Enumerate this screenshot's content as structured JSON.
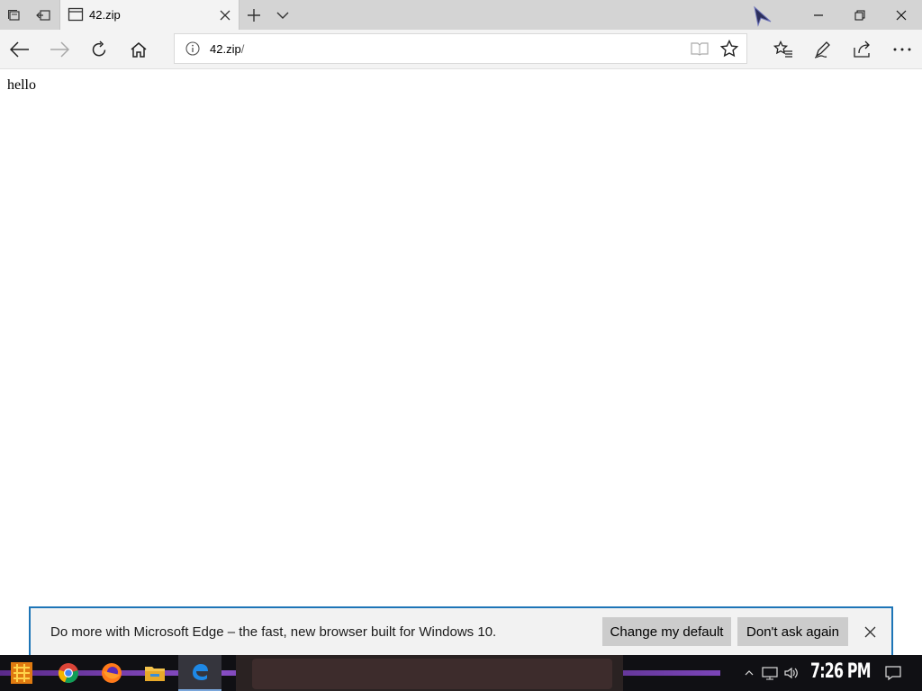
{
  "browser": {
    "tab": {
      "title": "42.zip"
    },
    "address": {
      "url_main": "42.zip",
      "url_rest": "/"
    }
  },
  "page": {
    "body_text": "hello"
  },
  "notification": {
    "message": "Do more with Microsoft Edge – the fast, new browser built for Windows 10.",
    "primary_button": "Change my default",
    "secondary_button": "Don't ask again"
  },
  "taskbar": {
    "clock": "7:26 PM",
    "pinned": [
      "start-icon",
      "chrome-icon",
      "firefox-icon",
      "file-explorer-icon",
      "edge-icon"
    ]
  },
  "colors": {
    "titlebar": "#d4d4d4",
    "toolbar": "#f3f3f3",
    "notification_border": "#1d75b7",
    "notification_button": "#cccccc",
    "taskbar": "#101014"
  }
}
